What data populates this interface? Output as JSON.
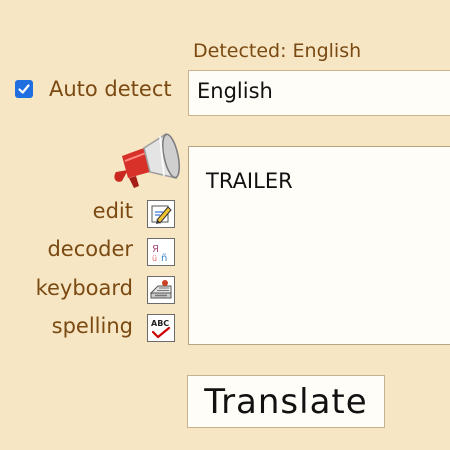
{
  "detected_label": "Detected: English",
  "auto_detect": {
    "label": "Auto detect",
    "checked": true
  },
  "language_field": {
    "value": "English"
  },
  "tools": [
    {
      "label": "edit",
      "icon": "edit-icon"
    },
    {
      "label": "decoder",
      "icon": "decoder-icon"
    },
    {
      "label": "keyboard",
      "icon": "keyboard-icon"
    },
    {
      "label": "spelling",
      "icon": "spelling-icon"
    }
  ],
  "text_input": {
    "value": "TRAILER"
  },
  "translate_button": {
    "label": "Translate"
  },
  "colors": {
    "background": "#f7e6c4",
    "label_text": "#7a4a12",
    "checkbox_accent": "#1f6fe0"
  },
  "icons": {
    "speaker": "megaphone-icon",
    "check": "check-icon"
  }
}
